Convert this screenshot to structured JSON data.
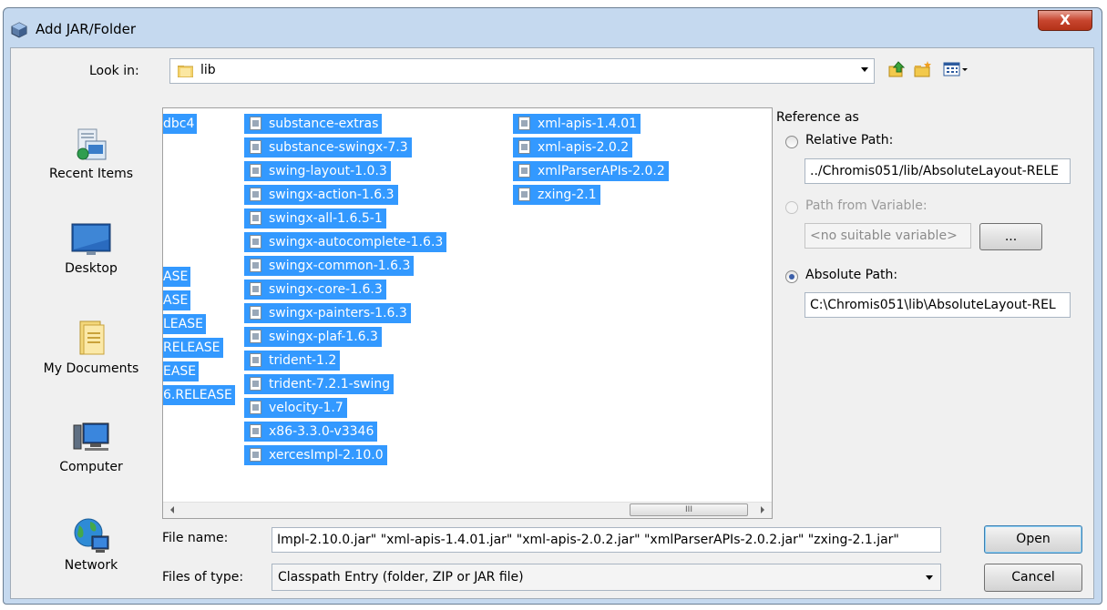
{
  "window": {
    "title": "Add JAR/Folder",
    "close_label": "X"
  },
  "lookin": {
    "label": "Look in:",
    "value": "lib"
  },
  "places": [
    {
      "label": "Recent Items",
      "icon": "recent-items-icon"
    },
    {
      "label": "Desktop",
      "icon": "desktop-icon"
    },
    {
      "label": "My Documents",
      "icon": "my-documents-icon"
    },
    {
      "label": "Computer",
      "icon": "computer-icon"
    },
    {
      "label": "Network",
      "icon": "network-icon"
    }
  ],
  "files": {
    "col0_partial": [
      "dbc4",
      "ASE",
      "ASE",
      "LEASE",
      "RELEASE",
      "EASE",
      "6.RELEASE"
    ],
    "col1": [
      "substance-extras",
      "substance-swingx-7.3",
      "swing-layout-1.0.3",
      "swingx-action-1.6.3",
      "swingx-all-1.6.5-1",
      "swingx-autocomplete-1.6.3",
      "swingx-common-1.6.3",
      "swingx-core-1.6.3",
      "swingx-painters-1.6.3",
      "swingx-plaf-1.6.3",
      "trident-1.2",
      "trident-7.2.1-swing",
      "velocity-1.7",
      "x86-3.3.0-v3346",
      "xercesImpl-2.10.0"
    ],
    "col2": [
      "xml-apis-1.4.01",
      "xml-apis-2.0.2",
      "xmlParserAPIs-2.0.2",
      "zxing-2.1"
    ],
    "scroll_grip": "III"
  },
  "reference": {
    "title": "Reference as",
    "relative_label": "Relative Path:",
    "relative_value": "../Chromis051/lib/AbsoluteLayout-RELE",
    "variable_label": "Path from Variable:",
    "variable_value": "<no suitable variable>",
    "browse_label": "...",
    "absolute_label": "Absolute Path:",
    "absolute_value": "C:\\Chromis051\\lib\\AbsoluteLayout-REL",
    "selected": "absolute"
  },
  "filename": {
    "label": "File name:",
    "value": "Impl-2.10.0.jar\" \"xml-apis-1.4.01.jar\" \"xml-apis-2.0.2.jar\" \"xmlParserAPIs-2.0.2.jar\" \"zxing-2.1.jar\""
  },
  "filetype": {
    "label": "Files of type:",
    "value": "Classpath Entry (folder, ZIP or JAR file)"
  },
  "buttons": {
    "open": "Open",
    "cancel": "Cancel"
  }
}
